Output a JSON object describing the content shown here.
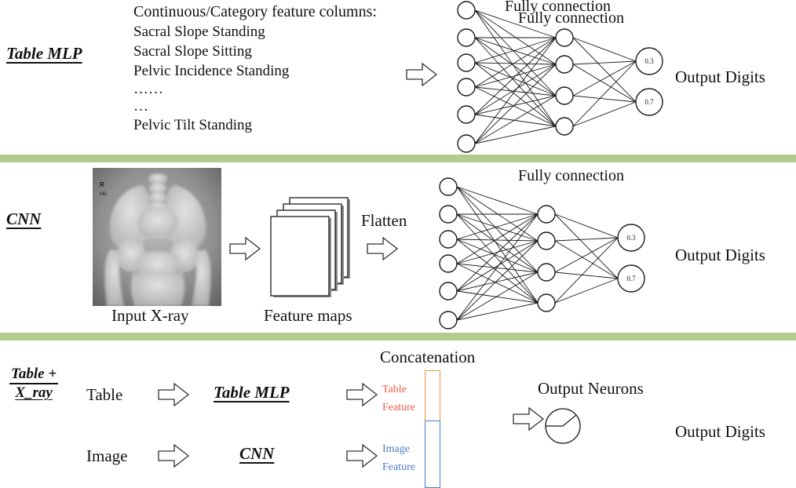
{
  "dividers": {
    "color": "#AFCE8E",
    "count": 2
  },
  "panel1": {
    "row_label": "Table MLP",
    "feature_header": "Continuous/Category feature columns:",
    "feature_items": [
      "Sacral Slope Standing",
      "Sacral Slope Sitting",
      "Pelvic Incidence Standing",
      "……",
      "…",
      "Pelvic Tilt Standing"
    ],
    "fc_label_1": "Fully connection",
    "fc_label_2": "Fully connection",
    "output_label": "Output Digits",
    "network": {
      "input_nodes": 6,
      "hidden_nodes": 4,
      "output_values": [
        "0.3",
        "0.7"
      ]
    }
  },
  "panel2": {
    "row_label": "CNN",
    "image_caption": "Input X-ray",
    "image_marker": "R",
    "featuremaps_caption": "Feature maps",
    "flatten_label": "Flatten",
    "fc_label": "Fully connection",
    "output_label": "Output Digits",
    "network": {
      "input_nodes": 6,
      "hidden_nodes": 4,
      "output_values": [
        "0.3",
        "0.7"
      ]
    }
  },
  "panel3": {
    "row_label_top": "Table +",
    "row_label_bottom": "X_ray",
    "input_table": "Table",
    "input_image": "Image",
    "model_table": "Table MLP",
    "model_cnn": "CNN",
    "concat_title": "Concatenation",
    "table_feature_l1": "Table",
    "table_feature_l2": "Feature",
    "image_feature_l1": "Image",
    "image_feature_l2": "Feature",
    "output_neurons_label": "Output Neurons",
    "output_label": "Output Digits",
    "colors": {
      "table_feature": "#ED5B4A",
      "table_border": "#E8943A",
      "image_feature": "#4A7BC8",
      "image_border": "#4A7BC8"
    }
  }
}
